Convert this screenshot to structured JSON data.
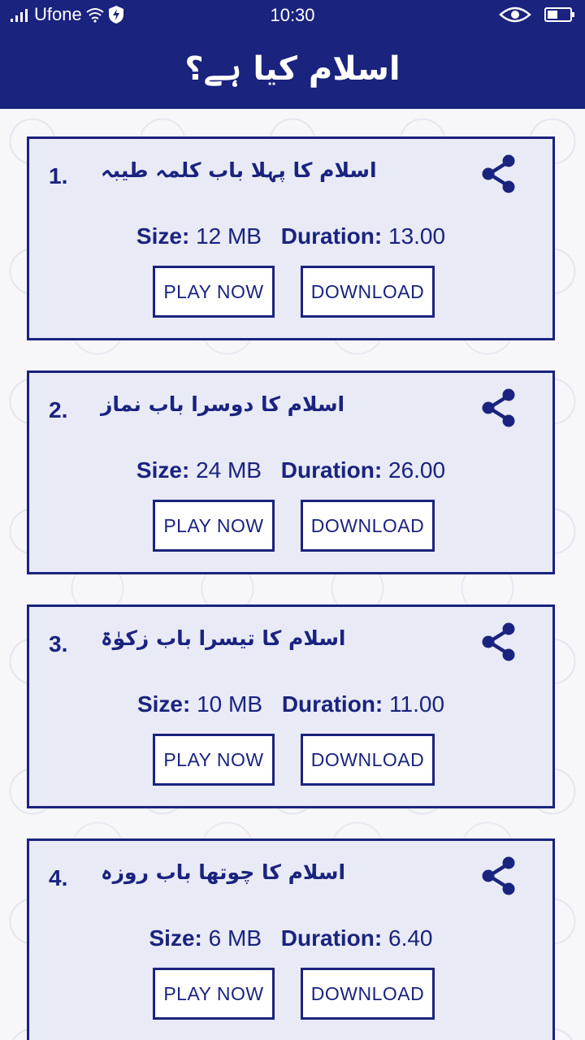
{
  "status_bar": {
    "carrier": "Ufone",
    "time": "10:30"
  },
  "header": {
    "title": "اسلام کیا ہے؟"
  },
  "lessons": [
    {
      "number": "1.",
      "title": "اسلام کا پہلا باب کلمہ طیبہ",
      "size_label": "Size:",
      "size": "12 MB",
      "duration_label": "Duration:",
      "duration": "13.00",
      "play_label": "PLAY NOW",
      "download_label": "DOWNLOAD"
    },
    {
      "number": "2.",
      "title": "اسلام کا دوسرا باب نماز",
      "size_label": "Size:",
      "size": "24 MB",
      "duration_label": "Duration:",
      "duration": "26.00",
      "play_label": "PLAY NOW",
      "download_label": "DOWNLOAD"
    },
    {
      "number": "3.",
      "title": "اسلام کا تیسرا باب زکوٰۃ",
      "size_label": "Size:",
      "size": "10 MB",
      "duration_label": "Duration:",
      "duration": "11.00",
      "play_label": "PLAY NOW",
      "download_label": "DOWNLOAD"
    },
    {
      "number": "4.",
      "title": "اسلام کا چوتھا باب روزہ",
      "size_label": "Size:",
      "size": "6 MB",
      "duration_label": "Duration:",
      "duration": "6.40",
      "play_label": "PLAY NOW",
      "download_label": "DOWNLOAD"
    }
  ],
  "icons": {
    "share": "share-icon",
    "signal": "signal-icon",
    "wifi": "wifi-icon",
    "shield": "shield-icon",
    "eye": "eye-icon",
    "battery": "battery-icon"
  },
  "colors": {
    "primary": "#1a237e",
    "card_bg": "#e8eaf6",
    "button_bg": "#ffffff"
  }
}
